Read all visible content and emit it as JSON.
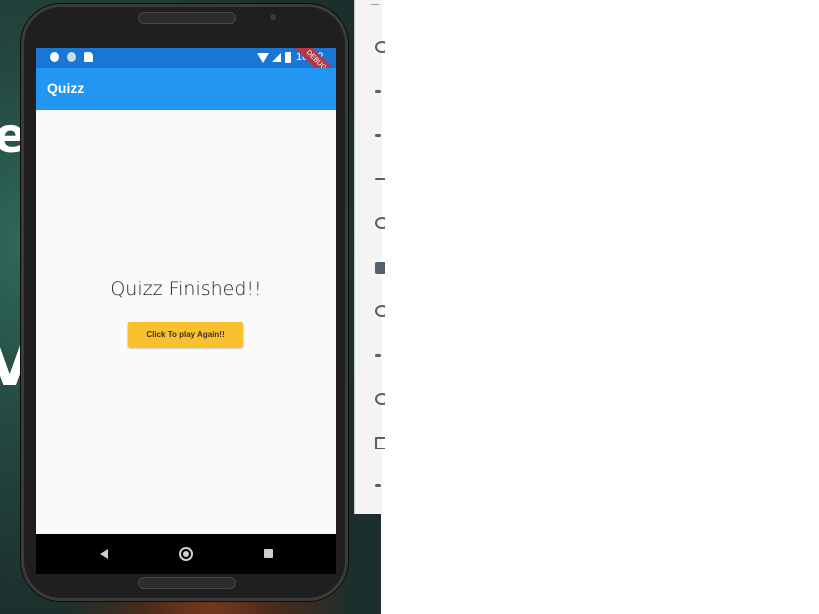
{
  "status_bar": {
    "time": "10:52",
    "debug_banner": "DEBUG",
    "icons": [
      "gear-icon",
      "shield-icon",
      "sd-card-icon",
      "wifi-icon",
      "signal-icon",
      "battery-icon"
    ]
  },
  "app_bar": {
    "title": "Quizz",
    "color": "#2196f3"
  },
  "main": {
    "finished_text": "Quizz Finished!!",
    "play_again_label": "Click To play Again!!",
    "button_color": "#fbc02d"
  },
  "nav_bar": {
    "icons": [
      "back-icon",
      "home-icon",
      "recent-apps-icon"
    ]
  },
  "side_toolbar": {
    "icons": [
      "power-icon",
      "volume-up-icon",
      "volume-down-icon",
      "rotate-left-icon",
      "rotate-right-icon",
      "camera-icon",
      "zoom-icon",
      "back-icon",
      "home-icon",
      "overview-icon",
      "more-icon"
    ]
  }
}
